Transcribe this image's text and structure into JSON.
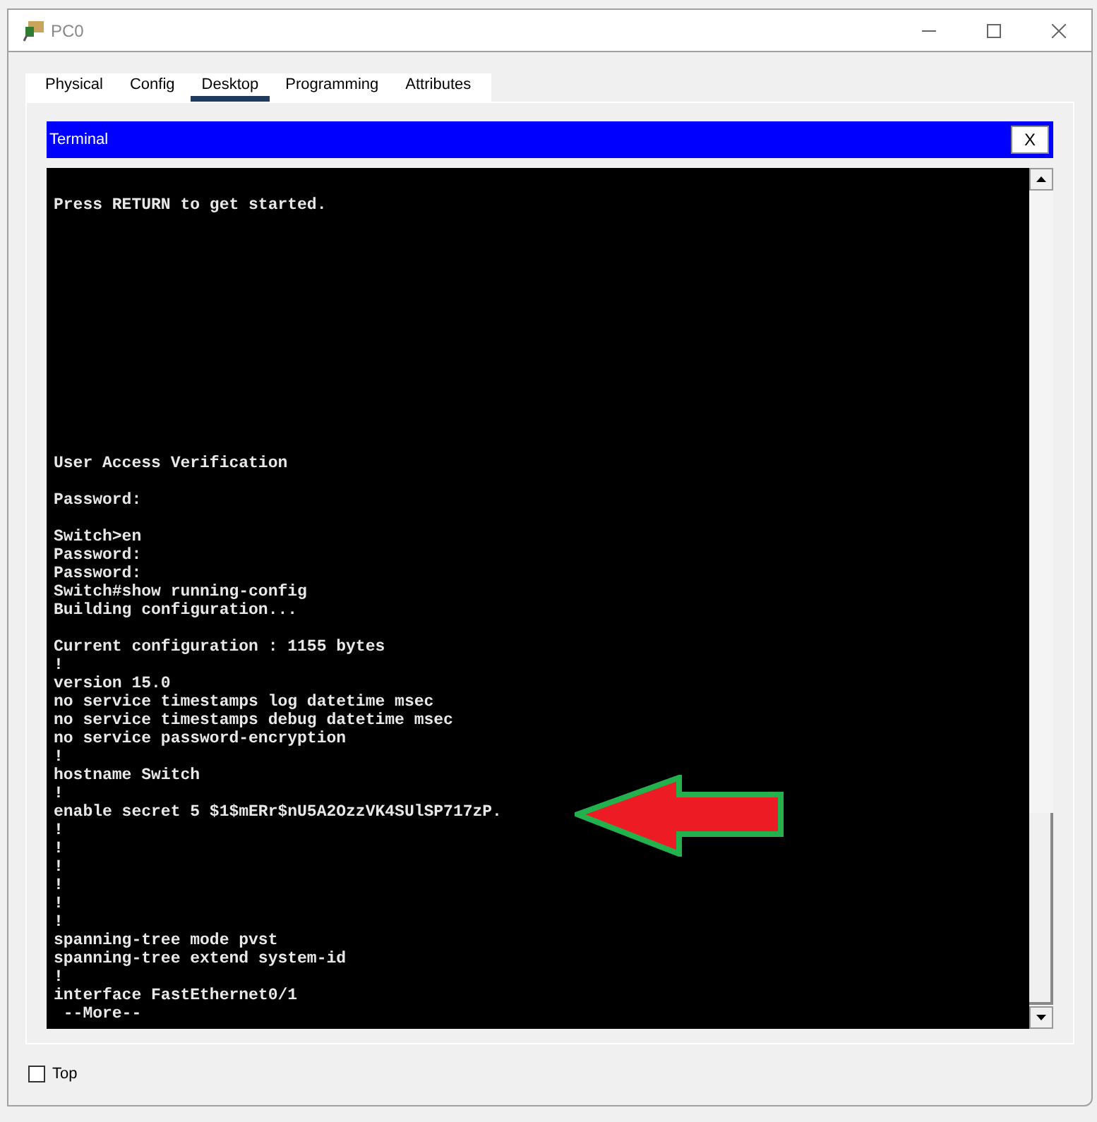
{
  "window": {
    "title": "PC0"
  },
  "tabs": [
    {
      "label": "Physical",
      "selected": false
    },
    {
      "label": "Config",
      "selected": false
    },
    {
      "label": "Desktop",
      "selected": true
    },
    {
      "label": "Programming",
      "selected": false
    },
    {
      "label": "Attributes",
      "selected": false
    }
  ],
  "terminal": {
    "title": "Terminal",
    "close_label": "X",
    "header_block": [
      "Press RETURN to get started."
    ],
    "blocks": [
      [
        "User Access Verification"
      ],
      [
        "Password:"
      ],
      [
        "Switch>en",
        "Password:",
        "Password:",
        "Switch#show running-config",
        "Building configuration..."
      ],
      [
        "Current configuration : 1155 bytes",
        "!",
        "version 15.0",
        "no service timestamps log datetime msec",
        "no service timestamps debug datetime msec",
        "no service password-encryption",
        "!",
        "hostname Switch",
        "!",
        "enable secret 5 $1$mERr$nU5A2OzzVK4SUlSP717zP.",
        "!",
        "!",
        "!",
        "!",
        "!",
        "!",
        "spanning-tree mode pvst",
        "spanning-tree extend system-id",
        "!",
        "interface FastEthernet0/1",
        " --More--"
      ]
    ]
  },
  "top_checkbox": {
    "label": "Top",
    "checked": false
  }
}
